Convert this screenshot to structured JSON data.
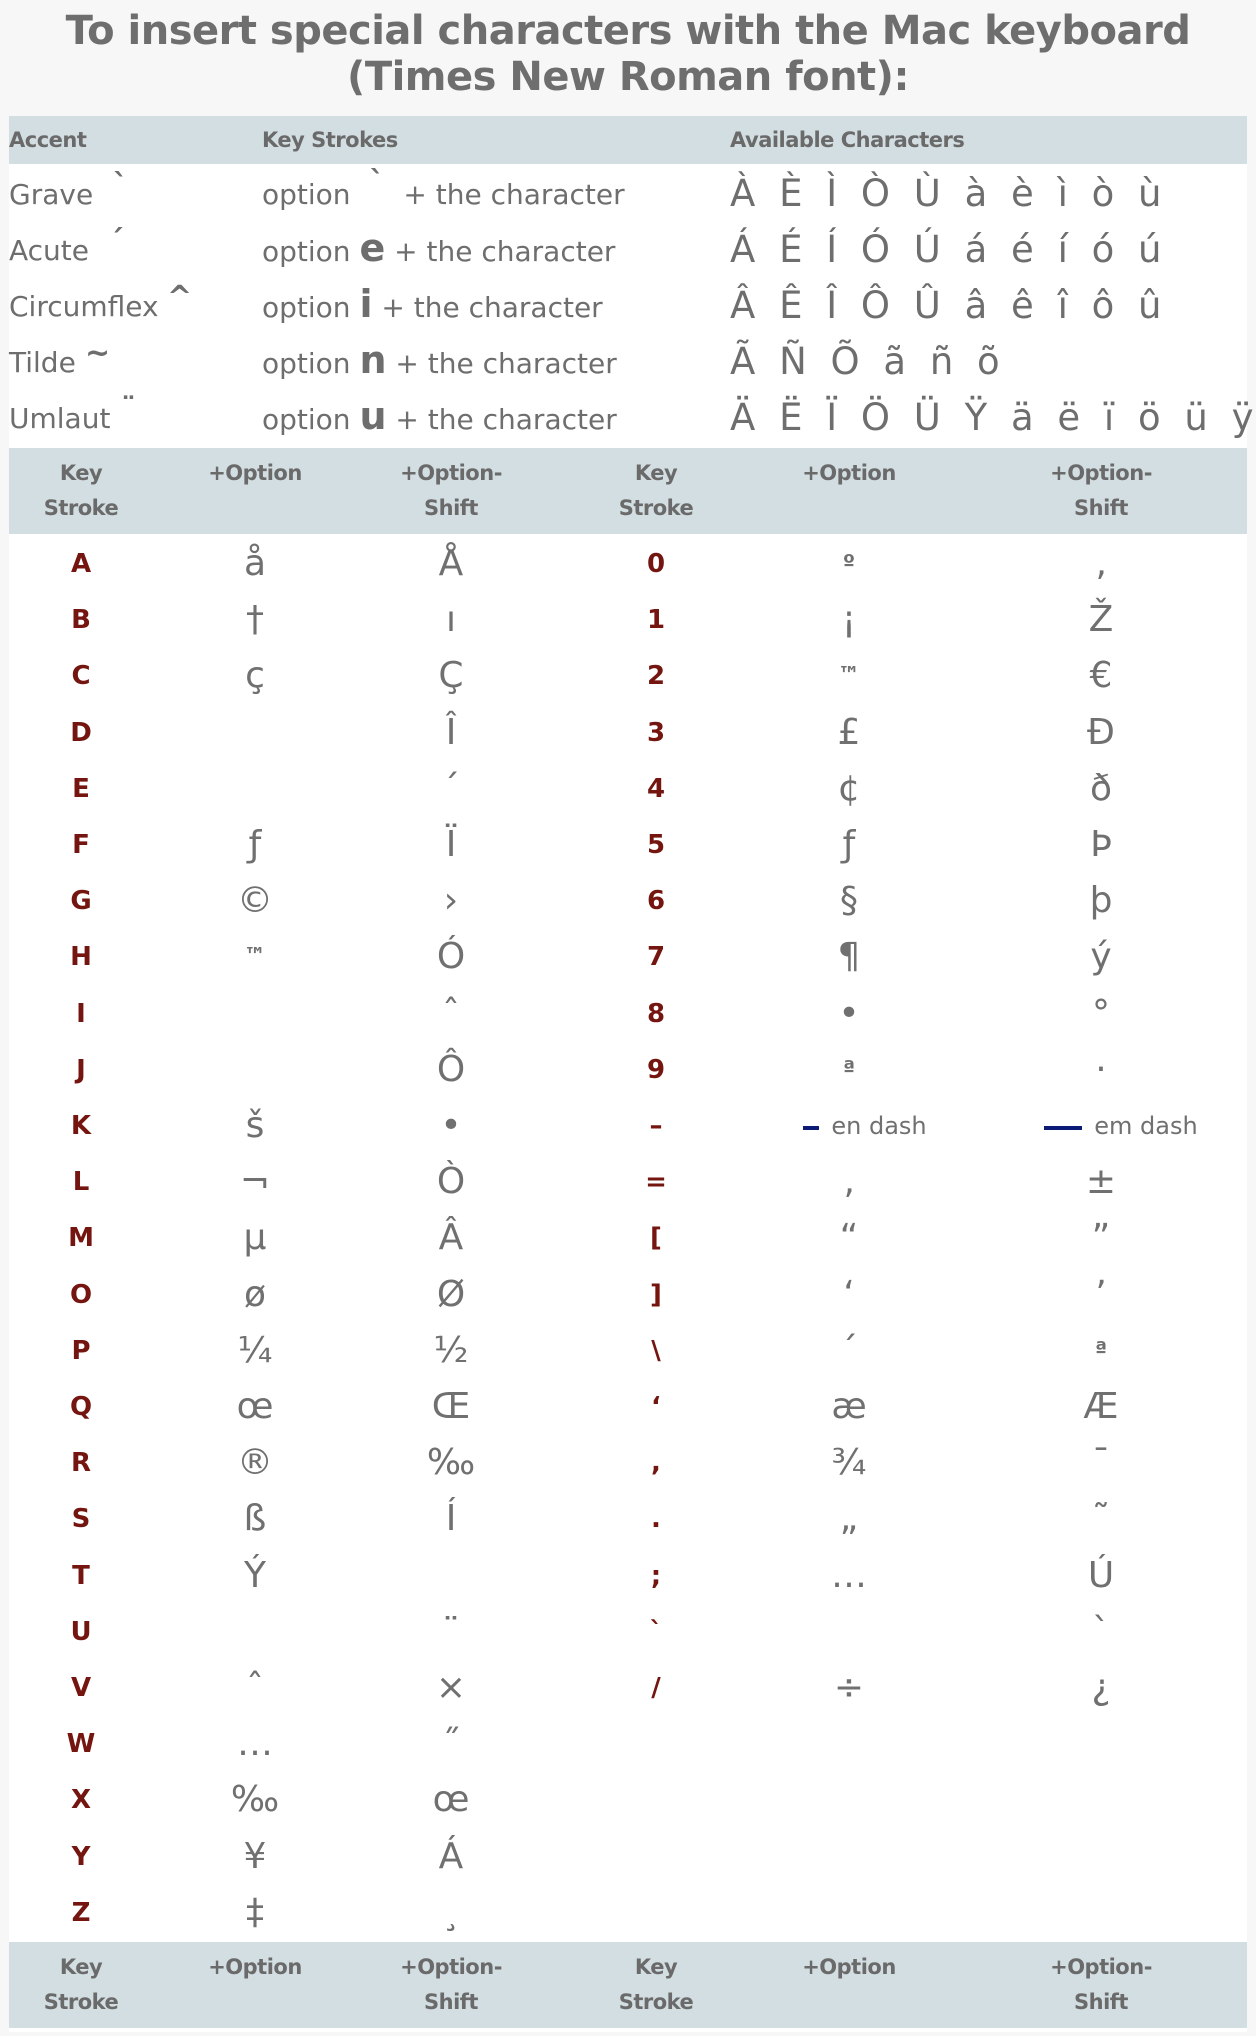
{
  "title_line1": "To insert special characters with the Mac keyboard",
  "title_line2": "(Times New Roman font):",
  "accent_table": {
    "headers": {
      "accent": "Accent",
      "key_strokes": "Key Strokes",
      "available": "Available Characters"
    },
    "rows": [
      {
        "name": "Grave",
        "mark": "`",
        "keys_prefix": "option",
        "keys_key": "`",
        "keys_suffix": "+ the character",
        "chars": "À È Ì Ò Ù à è ì ò ù"
      },
      {
        "name": "Acute",
        "mark": "´",
        "keys_prefix": "option",
        "keys_key": "e",
        "keys_suffix": "+ the character",
        "chars": "Á É Í Ó Ú á é í ó ú"
      },
      {
        "name": "Circumflex",
        "mark": "^",
        "keys_prefix": "option",
        "keys_key": "i",
        "keys_suffix": "+ the character",
        "chars": "Â Ê Î Ô Û â ê î ô û"
      },
      {
        "name": "Tilde",
        "mark": "~",
        "keys_prefix": "option",
        "keys_key": "n",
        "keys_suffix": "+ the character",
        "chars": "Ã Ñ Õ ã ñ õ"
      },
      {
        "name": "Umlaut",
        "mark": "¨",
        "keys_prefix": "option",
        "keys_key": "u",
        "keys_suffix": "+ the character",
        "chars": "Ä Ë Ï Ö Ü Ÿ ä ë ï ö ü ÿ"
      }
    ]
  },
  "key_table": {
    "headers": {
      "key_stroke_1": "Key",
      "key_stroke_2": "Stroke",
      "option": "+Option",
      "option_shift_1": "+Option-",
      "option_shift_2": "Shift"
    },
    "accent_colors": {
      "key_text": "#741510",
      "dash_marker": "#0c1a78",
      "header_bg": "#d3dee2"
    },
    "left": [
      {
        "key": "A",
        "option": "å",
        "option_shift": "Å"
      },
      {
        "key": "B",
        "option": "†",
        "option_shift": "ı"
      },
      {
        "key": "C",
        "option": "ç",
        "option_shift": "Ç"
      },
      {
        "key": "D",
        "option": "",
        "option_shift": "Î"
      },
      {
        "key": "E",
        "option": "",
        "option_shift": "´"
      },
      {
        "key": "F",
        "option": "ƒ",
        "option_shift": "Ï"
      },
      {
        "key": "G",
        "option": "©",
        "option_shift": "›"
      },
      {
        "key": "H",
        "option": "™",
        "option_shift": "Ó"
      },
      {
        "key": "I",
        "option": "",
        "option_shift": "ˆ"
      },
      {
        "key": "J",
        "option": "",
        "option_shift": "Ô"
      },
      {
        "key": "K",
        "option": "š",
        "option_shift": "•"
      },
      {
        "key": "L",
        "option": "¬",
        "option_shift": "Ò"
      },
      {
        "key": "M",
        "option": "µ",
        "option_shift": "Â"
      },
      {
        "key": "O",
        "option": "ø",
        "option_shift": "Ø"
      },
      {
        "key": "P",
        "option": "¼",
        "option_shift": "½"
      },
      {
        "key": "Q",
        "option": "œ",
        "option_shift": "Œ"
      },
      {
        "key": "R",
        "option": "®",
        "option_shift": "‰"
      },
      {
        "key": "S",
        "option": "ß",
        "option_shift": "Í"
      },
      {
        "key": "T",
        "option": "Ý",
        "option_shift": ""
      },
      {
        "key": "U",
        "option": "",
        "option_shift": "¨"
      },
      {
        "key": "V",
        "option": "ˆ",
        "option_shift": "×"
      },
      {
        "key": "W",
        "option": "…",
        "option_shift": "˝"
      },
      {
        "key": "X",
        "option": "‰",
        "option_shift": "œ"
      },
      {
        "key": "Y",
        "option": "¥",
        "option_shift": "Á"
      },
      {
        "key": "Z",
        "option": "‡",
        "option_shift": "¸"
      }
    ],
    "right": [
      {
        "key": "0",
        "option": "º",
        "option_shift": "‚"
      },
      {
        "key": "1",
        "option": "¡",
        "option_shift": "Ž"
      },
      {
        "key": "2",
        "option": "™",
        "option_shift": "€"
      },
      {
        "key": "3",
        "option": "£",
        "option_shift": "Đ"
      },
      {
        "key": "4",
        "option": "¢",
        "option_shift": "ð"
      },
      {
        "key": "5",
        "option": "ƒ",
        "option_shift": "Þ"
      },
      {
        "key": "6",
        "option": "§",
        "option_shift": "þ"
      },
      {
        "key": "7",
        "option": "¶",
        "option_shift": "ý"
      },
      {
        "key": "8",
        "option": "•",
        "option_shift": "°"
      },
      {
        "key": "9",
        "option": "ª",
        "option_shift": "·"
      },
      {
        "key": "–",
        "option": "en dash",
        "option_shift": "em dash"
      },
      {
        "key": "=",
        "option": "‚",
        "option_shift": "±"
      },
      {
        "key": "[",
        "option": "“",
        "option_shift": "”"
      },
      {
        "key": "]",
        "option": "‘",
        "option_shift": "’"
      },
      {
        "key": "\\",
        "option": "´",
        "option_shift": "ª"
      },
      {
        "key": "‘",
        "option": "æ",
        "option_shift": "Æ"
      },
      {
        "key": ",",
        "option": "¾",
        "option_shift": "¯"
      },
      {
        "key": ".",
        "option": "„",
        "option_shift": "˜"
      },
      {
        "key": ";",
        "option": "…",
        "option_shift": "Ú"
      },
      {
        "key": "`",
        "option": "",
        "option_shift": "`"
      },
      {
        "key": "/",
        "option": "÷",
        "option_shift": "¿"
      }
    ]
  }
}
